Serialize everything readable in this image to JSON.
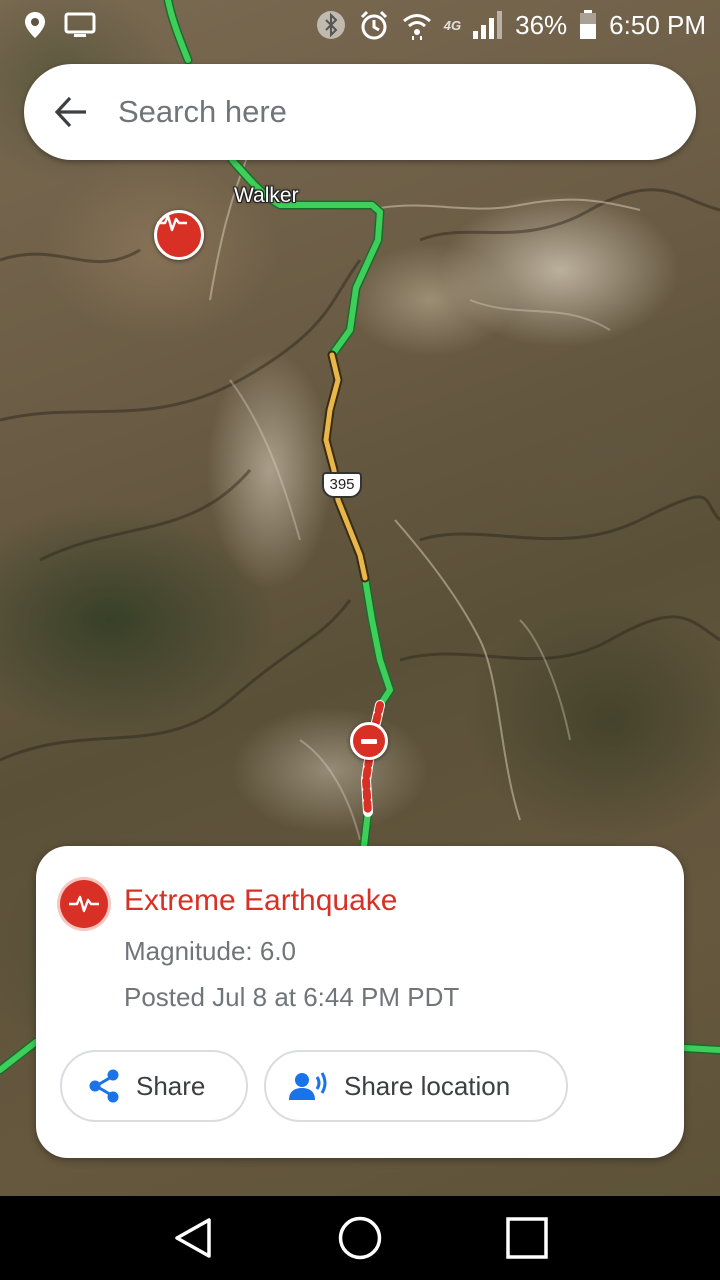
{
  "status_bar": {
    "network_type": "4G",
    "battery_percent": "36%",
    "time": "6:50 PM",
    "icons": [
      "location-icon",
      "cast-screen-icon",
      "bluetooth-icon",
      "alarm-icon",
      "wifi-icon",
      "signal-icon",
      "battery-icon"
    ]
  },
  "search": {
    "placeholder": "Search here",
    "value": ""
  },
  "map": {
    "town_label": "Walker",
    "route_number": "395",
    "colors": {
      "traffic_clear": "#3ecf5a",
      "traffic_slow": "#e8b64a",
      "closure": "#d93025"
    }
  },
  "alert": {
    "title": "Extreme Earthquake",
    "magnitude_text": "Magnitude: 6.0",
    "posted_text": "Posted Jul 8 at 6:44 PM PDT",
    "accent_color": "#d93025",
    "actions": {
      "share_label": "Share",
      "share_location_label": "Share location"
    }
  },
  "nav_bar": {
    "buttons": [
      "back-icon",
      "home-icon",
      "recents-icon"
    ]
  }
}
